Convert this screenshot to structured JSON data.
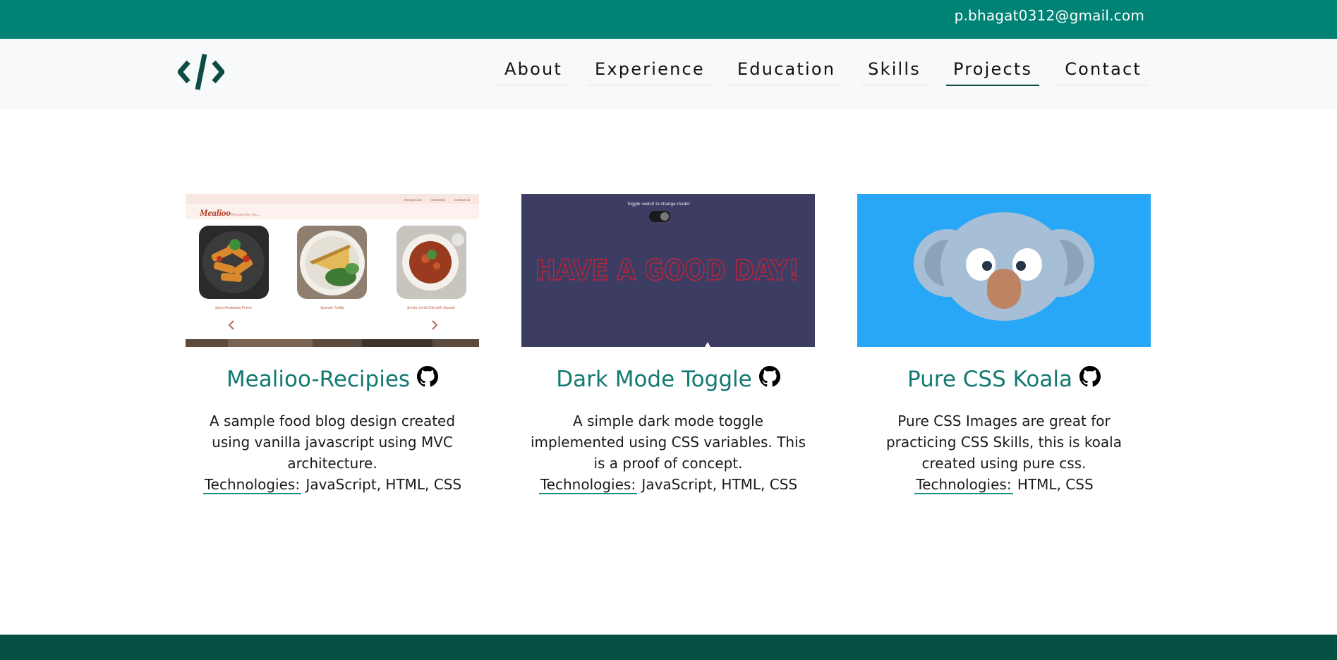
{
  "topbar": {
    "email": "p.bhagat0312@gmail.com"
  },
  "logo": {
    "icon": "code-brackets-icon",
    "color": "#0d4c44"
  },
  "nav": {
    "items": [
      "About",
      "Experience",
      "Education",
      "Skills",
      "Projects",
      "Contact"
    ],
    "active": "Projects"
  },
  "projects": [
    {
      "title": "Mealioo-Recipies",
      "description": "A sample food blog design created using vanilla javascript using MVC architecture.",
      "tech_label": "Technologies:",
      "tech_value": " JavaScript, HTML, CSS",
      "thumbnail": {
        "brand": "Mealioo",
        "tagline": "Recipes for you...",
        "nav_links": [
          "Recipes List",
          "Subscribe",
          "Contact Us"
        ],
        "dishes": [
          "Spicy Arrabbiata Penne",
          "Spanish Tortilla",
          "Smoky Lentil Chili with Squash"
        ]
      }
    },
    {
      "title": "Dark Mode Toggle",
      "description": "A simple dark mode toggle implemented using CSS variables. This is a proof of concept.",
      "tech_label": "Technologies:",
      "tech_value": " JavaScript, HTML, CSS",
      "thumbnail": {
        "caption": "Toggle switch to change mode!",
        "banner": "HAVE A GOOD DAY!"
      }
    },
    {
      "title": "Pure CSS Koala",
      "description": "Pure CSS Images are great for practicing CSS Skills, this is koala created using pure css.",
      "tech_label": "Technologies:",
      "tech_value": " HTML, CSS",
      "thumbnail": {}
    }
  ],
  "colors": {
    "topbar": "#008275",
    "footer": "#054f45",
    "accent": "#137a72"
  }
}
